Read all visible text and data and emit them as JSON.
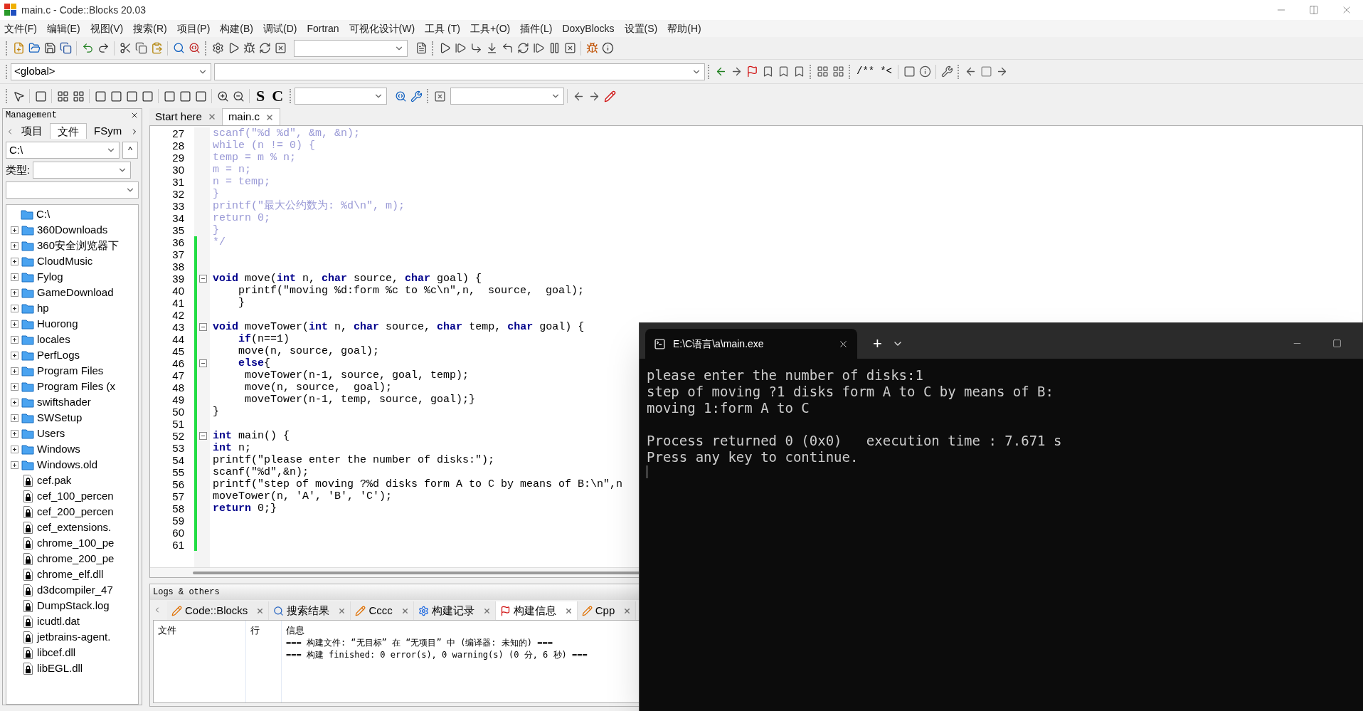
{
  "window": {
    "title": "main.c - Code::Blocks 20.03"
  },
  "menu": [
    "文件(F)",
    "编辑(E)",
    "视图(V)",
    "搜索(R)",
    "项目(P)",
    "构建(B)",
    "调试(D)",
    "Fortran",
    "可视化设计(W)",
    "工具 (T)",
    "工具+(O)",
    "插件(L)",
    "DoxyBlocks",
    "设置(S)",
    "帮助(H)"
  ],
  "toolbar": {
    "scope": "<global>",
    "text_buttons": [
      "S",
      "C"
    ],
    "doc_buttons": [
      "/**",
      "*<"
    ]
  },
  "management": {
    "title": "Management",
    "tabs": [
      {
        "label": "项目",
        "selected": false
      },
      {
        "label": "文件",
        "selected": true
      },
      {
        "label": "FSym",
        "selected": false
      }
    ],
    "path": "C:\\",
    "up_button": "^",
    "type_label": "类型:",
    "tree": {
      "label": "C:\\",
      "children": [
        {
          "label": "360Downloads",
          "kind": "folder",
          "expanded": false
        },
        {
          "label": "360安全浏览器下",
          "kind": "folder",
          "expanded": false
        },
        {
          "label": "CloudMusic",
          "kind": "folder",
          "expanded": false
        },
        {
          "label": "Fylog",
          "kind": "folder",
          "expanded": false
        },
        {
          "label": "GameDownload",
          "kind": "folder",
          "expanded": false
        },
        {
          "label": "hp",
          "kind": "folder",
          "expanded": false
        },
        {
          "label": "Huorong",
          "kind": "folder",
          "expanded": false
        },
        {
          "label": "locales",
          "kind": "folder",
          "expanded": false
        },
        {
          "label": "PerfLogs",
          "kind": "folder",
          "expanded": false
        },
        {
          "label": "Program Files",
          "kind": "folder",
          "expanded": false
        },
        {
          "label": "Program Files (x",
          "kind": "folder",
          "expanded": false
        },
        {
          "label": "swiftshader",
          "kind": "folder",
          "expanded": false
        },
        {
          "label": "SWSetup",
          "kind": "folder",
          "expanded": false
        },
        {
          "label": "Users",
          "kind": "folder",
          "expanded": false
        },
        {
          "label": "Windows",
          "kind": "folder",
          "expanded": false
        },
        {
          "label": "Windows.old",
          "kind": "folder",
          "expanded": false
        },
        {
          "label": "cef.pak",
          "kind": "file"
        },
        {
          "label": "cef_100_percen",
          "kind": "file"
        },
        {
          "label": "cef_200_percen",
          "kind": "file"
        },
        {
          "label": "cef_extensions.",
          "kind": "file"
        },
        {
          "label": "chrome_100_pe",
          "kind": "file"
        },
        {
          "label": "chrome_200_pe",
          "kind": "file"
        },
        {
          "label": "chrome_elf.dll",
          "kind": "file"
        },
        {
          "label": "d3dcompiler_47",
          "kind": "file"
        },
        {
          "label": "DumpStack.log",
          "kind": "file"
        },
        {
          "label": "icudtl.dat",
          "kind": "file"
        },
        {
          "label": "jetbrains-agent.",
          "kind": "file"
        },
        {
          "label": "libcef.dll",
          "kind": "file"
        },
        {
          "label": "libEGL.dll",
          "kind": "file"
        }
      ]
    }
  },
  "editor": {
    "tabs": [
      {
        "label": "Start here",
        "selected": false
      },
      {
        "label": "main.c",
        "selected": true
      }
    ],
    "lines": [
      {
        "no": "27",
        "comment": true,
        "fold": false,
        "changed": false,
        "text": "scanf(\"%d %d\", &m, &n);"
      },
      {
        "no": "28",
        "comment": true,
        "fold": false,
        "changed": false,
        "text": "while (n != 0) {"
      },
      {
        "no": "29",
        "comment": true,
        "fold": false,
        "changed": false,
        "text": "temp = m % n;"
      },
      {
        "no": "30",
        "comment": true,
        "fold": false,
        "changed": false,
        "text": "m = n;"
      },
      {
        "no": "31",
        "comment": true,
        "fold": false,
        "changed": false,
        "text": "n = temp;"
      },
      {
        "no": "32",
        "comment": true,
        "fold": false,
        "changed": false,
        "text": "}"
      },
      {
        "no": "33",
        "comment": true,
        "fold": false,
        "changed": false,
        "text": "printf(\"最大公约数为: %d\\n\", m);"
      },
      {
        "no": "34",
        "comment": true,
        "fold": false,
        "changed": false,
        "text": "return 0;"
      },
      {
        "no": "35",
        "comment": true,
        "fold": false,
        "changed": false,
        "text": "}"
      },
      {
        "no": "36",
        "comment": true,
        "fold": false,
        "changed": true,
        "text": "*/"
      },
      {
        "no": "37",
        "fold": false,
        "changed": true
      },
      {
        "no": "38",
        "fold": false,
        "changed": true
      },
      {
        "no": "39",
        "comment": false,
        "fold": true,
        "changed": true,
        "text": "**void** move(**int** n, **char** source, **char** goal) {"
      },
      {
        "no": "40",
        "comment": false,
        "fold": false,
        "changed": true,
        "text": "    printf(\"moving %d:form %c to %c\\n\",n,  source,  goal);"
      },
      {
        "no": "41",
        "comment": false,
        "fold": false,
        "changed": true,
        "text": "    }"
      },
      {
        "no": "42",
        "fold": false,
        "changed": true
      },
      {
        "no": "43",
        "comment": false,
        "fold": true,
        "changed": true,
        "text": "**void** moveTower(**int** n, **char** source, **char** temp, **char** goal) {"
      },
      {
        "no": "44",
        "comment": false,
        "fold": false,
        "changed": true,
        "text": "    **if**(n==1)"
      },
      {
        "no": "45",
        "comment": false,
        "fold": false,
        "changed": true,
        "text": "    move(n, source, goal);"
      },
      {
        "no": "46",
        "comment": false,
        "fold": true,
        "changed": true,
        "text": "    **else**{"
      },
      {
        "no": "47",
        "comment": false,
        "fold": false,
        "changed": true,
        "text": "     moveTower(n-1, source, goal, temp);"
      },
      {
        "no": "48",
        "comment": false,
        "fold": false,
        "changed": true,
        "text": "     move(n, source,  goal);"
      },
      {
        "no": "49",
        "comment": false,
        "fold": false,
        "changed": true,
        "text": "     moveTower(n-1, temp, source, goal);}"
      },
      {
        "no": "50",
        "comment": false,
        "fold": false,
        "changed": true,
        "text": "}"
      },
      {
        "no": "51",
        "fold": false,
        "changed": true
      },
      {
        "no": "52",
        "comment": false,
        "fold": true,
        "changed": true,
        "text": "**int** main() {"
      },
      {
        "no": "53",
        "comment": false,
        "fold": false,
        "changed": true,
        "text": "**int** n;"
      },
      {
        "no": "54",
        "comment": false,
        "fold": false,
        "changed": true,
        "text": "printf(\"please enter the number of disks:\");"
      },
      {
        "no": "55",
        "comment": false,
        "fold": false,
        "changed": true,
        "text": "scanf(\"%d\",&n);"
      },
      {
        "no": "56",
        "comment": false,
        "fold": false,
        "changed": true,
        "text": "printf(\"step of moving ?%d disks form A to C by means of B:\\n\",n"
      },
      {
        "no": "57",
        "comment": false,
        "fold": false,
        "changed": true,
        "text": "moveTower(n, 'A', 'B', 'C');"
      },
      {
        "no": "58",
        "comment": false,
        "fold": false,
        "changed": true,
        "text": "**return** 0;}"
      },
      {
        "no": "59",
        "fold": false,
        "changed": true
      },
      {
        "no": "60",
        "fold": false,
        "changed": true
      },
      {
        "no": "61",
        "fold": false,
        "changed": true
      }
    ]
  },
  "logs": {
    "title": "Logs & others",
    "tabs": [
      {
        "label": "Code::Blocks",
        "selected": false
      },
      {
        "label": "搜索结果",
        "selected": false
      },
      {
        "label": "Cccc",
        "selected": false
      },
      {
        "label": "构建记录",
        "selected": false
      },
      {
        "label": "构建信息",
        "selected": true
      },
      {
        "label": "Cpp",
        "selected": false
      }
    ],
    "table": {
      "columns": [
        "文件",
        "行",
        "信息"
      ],
      "messages": [
        "=== 构建文件: “无目标” 在 “无项目” 中 (编译器: 未知的) ===",
        "=== 构建 finished: 0 error(s), 0 warning(s) (0 分, 6 秒) ==="
      ]
    }
  },
  "terminal": {
    "tab_title": "E:\\C语言\\a\\main.exe",
    "new_tab": "+",
    "output_blocks": [
      [
        "please enter the number of disks:1",
        "step of moving ?1 disks form A to C by means of B:",
        "moving 1:form A to C"
      ],
      [
        "Process returned 0 (0x0)   execution time : 7.671 s",
        "Press any key to continue."
      ]
    ]
  }
}
